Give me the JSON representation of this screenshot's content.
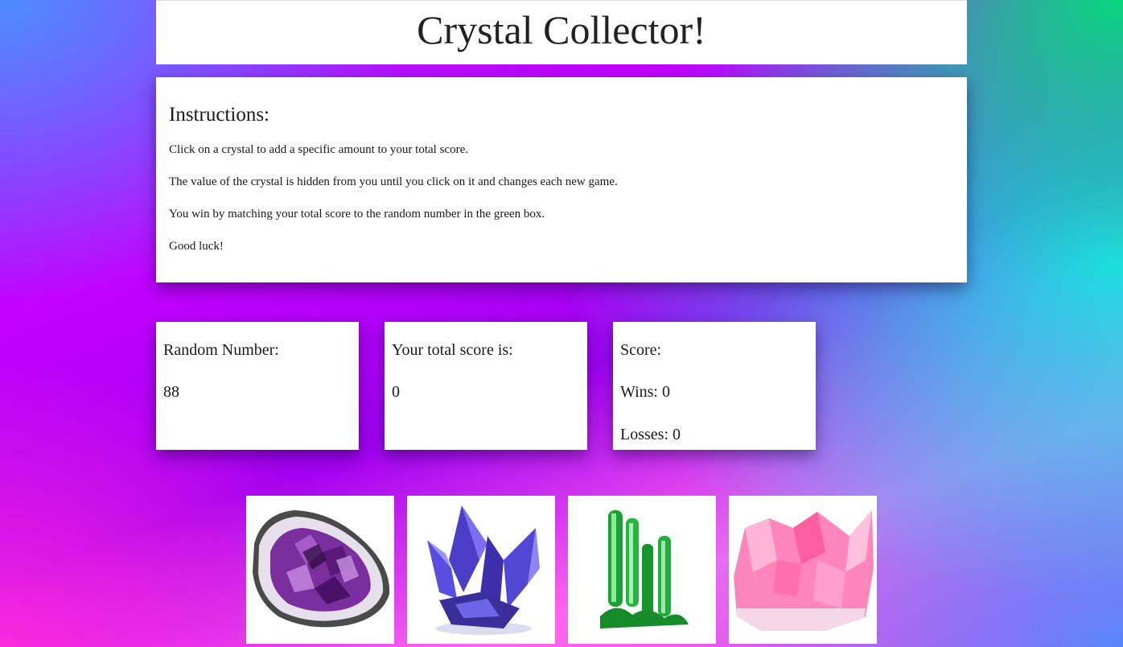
{
  "header": {
    "title": "Crystal Collector!"
  },
  "instructions": {
    "heading": "Instructions:",
    "lines": [
      "Click on a crystal to add a specific amount to your total score.",
      "The value of the crystal is hidden from you until you click on it and changes each new game.",
      "You win by matching your total score to the random number in the green box.",
      "Good luck!"
    ]
  },
  "random": {
    "label": "Random Number:",
    "value": "88"
  },
  "total": {
    "label": "Your total score is:",
    "value": "0"
  },
  "score": {
    "label": "Score:",
    "wins": "Wins: 0",
    "losses": "Losses: 0"
  },
  "crystals": [
    {
      "icon": "amethyst-geode-icon",
      "color": "#6a1f8a"
    },
    {
      "icon": "blue-violet-crystal-icon",
      "color": "#5a3fd0"
    },
    {
      "icon": "green-crystal-icon",
      "color": "#1fb33a"
    },
    {
      "icon": "pink-crystal-icon",
      "color": "#ff7fb5"
    }
  ]
}
